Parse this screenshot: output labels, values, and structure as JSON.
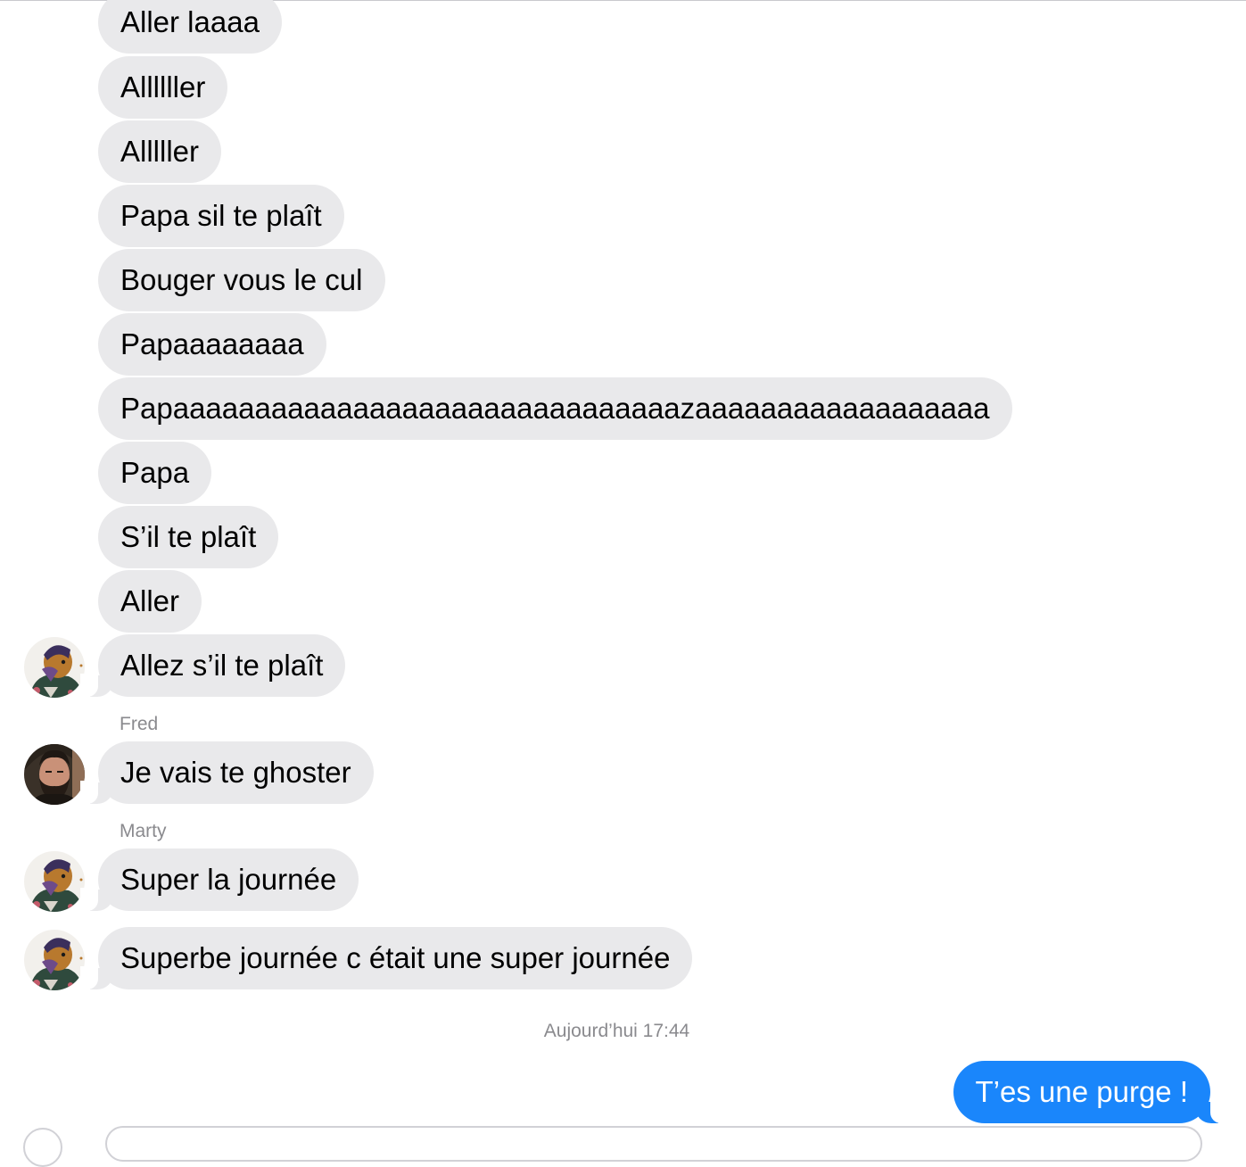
{
  "conversation": {
    "messages": [
      {
        "text": "Aller laaaa"
      },
      {
        "text": "Allllller"
      },
      {
        "text": "Alllller"
      },
      {
        "text": "Papa sil te plaît"
      },
      {
        "text": "Bouger vous le cul"
      },
      {
        "text": "Papaaaaaaaa"
      },
      {
        "text": "Papaaaaaaaaaaaaaaaaaaaaaaaaaaaaaaazaaaaaaaaaaaaaaaaaa"
      },
      {
        "text": "Papa"
      },
      {
        "text": "S’il te plaît"
      },
      {
        "text": "Aller"
      },
      {
        "text": "Allez s’il te plaît",
        "avatar": "character-avatar-icon"
      },
      {
        "sender": "Fred",
        "text": "Je vais te ghoster",
        "avatar": "bearded-man-avatar"
      },
      {
        "sender": "Marty",
        "text": "Super la journée",
        "avatar": "character-avatar-icon"
      },
      {
        "text": "Superbe journée c était une super journée",
        "avatar": "character-avatar-icon"
      }
    ],
    "timestamp": "Aujourd’hui 17:44",
    "outgoing": {
      "text": "T’es une purge !"
    }
  },
  "colors": {
    "incoming_bubble": "#e9e9eb",
    "outgoing_bubble": "#1a86fb",
    "meta_text": "#8a8a8e"
  }
}
